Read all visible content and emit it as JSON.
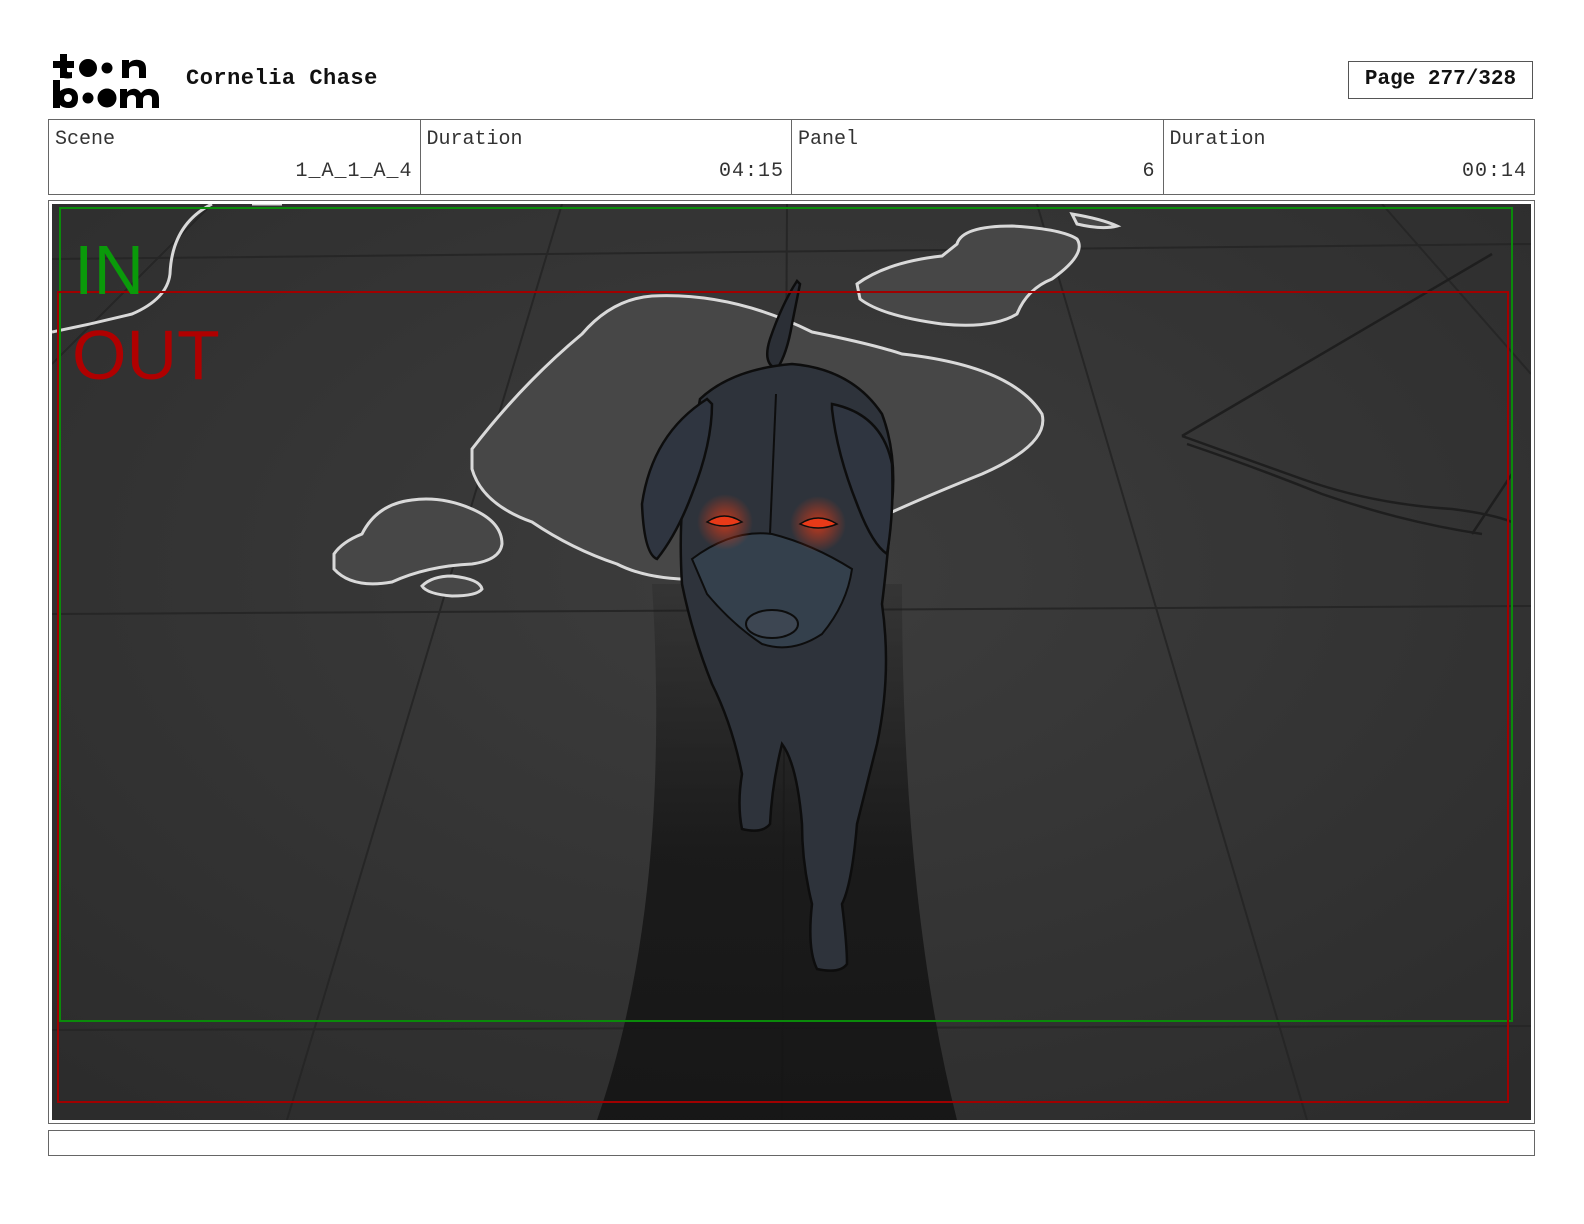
{
  "header": {
    "logo_text": "toon boom",
    "project_title": "Cornelia Chase",
    "page_label": "Page 277/328"
  },
  "info": {
    "scene_label": "Scene",
    "scene_value": "1_A_1_A_4",
    "scene_duration_label": "Duration",
    "scene_duration_value": "04:15",
    "panel_label": "Panel",
    "panel_value": "6",
    "panel_duration_label": "Duration",
    "panel_duration_value": "00:14"
  },
  "frame_marks": {
    "in_label": "IN",
    "out_label": "OUT",
    "in_color": "#0a9a0a",
    "out_color": "#b00000"
  },
  "caption": ""
}
